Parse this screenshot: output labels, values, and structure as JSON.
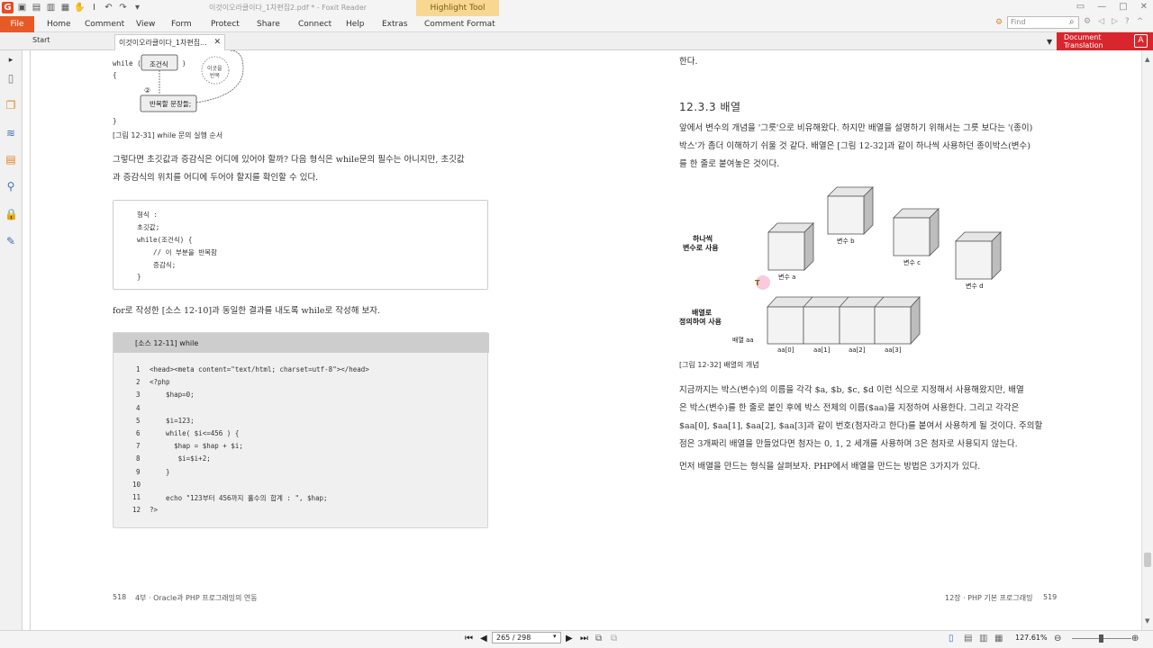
{
  "app": {
    "window_title": "이것이오라클이다_1차편집2.pdf * - Foxit Reader",
    "highlight_tool": "Highlight Tool",
    "file_menu": "File",
    "menus": [
      "Home",
      "Comment",
      "View",
      "Form",
      "Protect",
      "Share",
      "Connect",
      "Help",
      "Extras",
      "Comment Format"
    ],
    "find_placeholder": "Find"
  },
  "tabs": {
    "start": "Start",
    "doc": "이것이오라클이다_1차편집...",
    "doc_translation_line1": "Document",
    "doc_translation_line2": "Translation"
  },
  "status": {
    "page_display": "265 / 298",
    "zoom": "127.61%"
  },
  "left_page": {
    "diagram_labels": {
      "while_open": "while (",
      "brace_open": "{",
      "brace_close": "}",
      "cond": "조건식",
      "close_paren": ")",
      "circle2": "②",
      "loop_note1": "이곳을",
      "loop_note2": "반복",
      "body": "반복할 문장들;"
    },
    "fig_caption": "[그림 12-31] while 문의 실행 순서",
    "para1": [
      "그렇다면 초깃값과 증감식은 어디에 있어야 할까? 다음 형식은 while문의 필수는 아니지만, 초깃값",
      "과 증감식의 위치를 어디에 두어야 할지를 확인할 수 있다."
    ],
    "format_code": [
      "형식 :",
      "초깃값;",
      "while(조건식) {",
      "    // 이 부분을 반복함",
      "    증감식;",
      "}"
    ],
    "para2": "for로 작성한 [소스 12-10]과 동일한 결과를 내도록 while로 작성해 보자.",
    "source_title": "[소스 12-11] while",
    "source_lines": [
      {
        "n": "1",
        "code": "<head><meta content=\"text/html; charset=utf-8\"></head>"
      },
      {
        "n": "2",
        "code": "<?php"
      },
      {
        "n": "3",
        "code": "    $hap=0;"
      },
      {
        "n": "4",
        "code": ""
      },
      {
        "n": "5",
        "code": "    $i=123;"
      },
      {
        "n": "6",
        "code": "    while( $i<=456 ) {"
      },
      {
        "n": "7",
        "code": "      $hap = $hap + $i;"
      },
      {
        "n": "8",
        "code": "       $i=$i+2;"
      },
      {
        "n": "9",
        "code": "    }"
      },
      {
        "n": "10",
        "code": ""
      },
      {
        "n": "11",
        "code": "    echo \"123부터 456까지 홀수의 합계 : \", $hap;"
      },
      {
        "n": "12",
        "code": "?>"
      }
    ],
    "footer_num": "518",
    "footer_text": "4부 · Oracle과 PHP 프로그래밍의 연동"
  },
  "right_page": {
    "top_text": "한다.",
    "section_title": "12.3.3 배열",
    "para1": [
      "앞에서 변수의 개념을 '그릇'으로 비유해왔다. 하지만 배열을 설명하기 위해서는 그릇 보다는 '(종이)",
      "박스'가 좀더 이해하기 쉬울 것 같다. 배열은 [그림 12-32]과 같이 하나씩 사용하던 종이박스(변수)",
      "를 한 줄로 붙여놓은 것이다."
    ],
    "diagram": {
      "label_single_1": "하나씩",
      "label_single_2": "변수로 사용",
      "label_array_1": "배열로",
      "label_array_2": "정의하여 사용",
      "var_a": "변수 a",
      "var_b": "변수 b",
      "var_c": "변수 c",
      "var_d": "변수 d",
      "array_name": "배열 aa",
      "elements": [
        "aa[0]",
        "aa[1]",
        "aa[2]",
        "aa[3]"
      ]
    },
    "fig_caption": "[그림 12-32] 배열의 개념",
    "para2": [
      "지금까지는 박스(변수)의 이름을 각각 $a, $b, $c, $d 이런 식으로 지정해서 사용해왔지만, 배열",
      "은 박스(변수)를 한 줄로 붙인 후에 박스 전체의 이름($aa)을 지정하여 사용한다. 그리고 각각은",
      "$aa[0], $aa[1], $aa[2], $aa[3]과 같이 번호(첨자라고 한다)를 붙여서 사용하게 될 것이다. 주의할",
      "점은 3개짜리 배열을 만들었다면 첨자는 0, 1, 2 세개를 사용하며 3은 첨자로 사용되지 않는다."
    ],
    "para3": "먼저 배열을 만드는 형식을 살펴보자. PHP에서 배열을 만드는 방법은 3가지가 있다.",
    "footer_text": "12장 · PHP 기본 프로그래밍",
    "footer_num": "519"
  },
  "colors": {
    "file_button": "#e85a25",
    "doc_translation": "#d9262e",
    "highlight_tool": "#f8d792",
    "sidebar_icons": "#e1832b"
  }
}
